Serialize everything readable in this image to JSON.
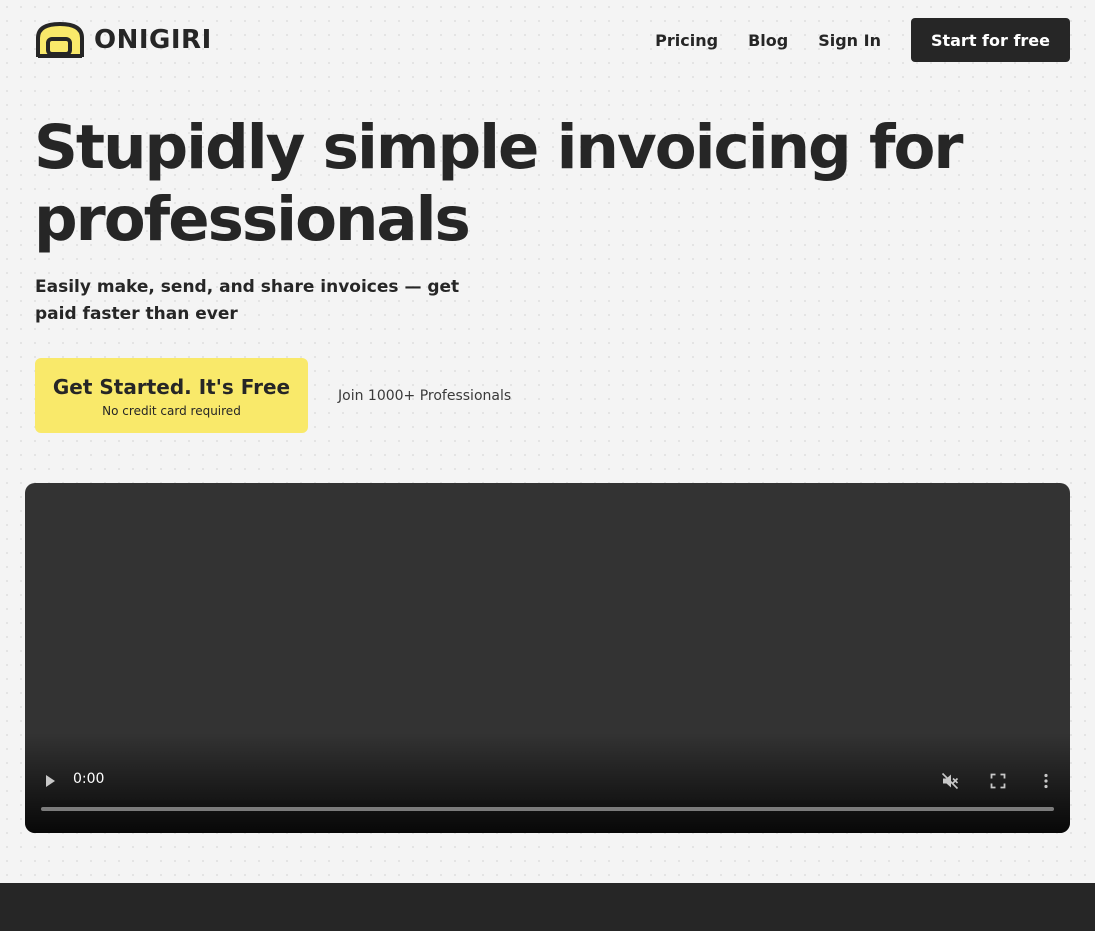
{
  "brand": {
    "name": "ONIGIRI",
    "accent": "#f9e96a",
    "dark": "#262626",
    "logo_icon": "onigiri-icon"
  },
  "nav": {
    "links": [
      {
        "label": "Pricing"
      },
      {
        "label": "Blog"
      },
      {
        "label": "Sign In"
      }
    ],
    "cta_label": "Start for free"
  },
  "hero": {
    "title": "Stupidly simple invoicing for professionals",
    "subtitle": "Easily make, send, and share invoices — get paid faster than ever",
    "cta_label": "Get Started. It's Free",
    "cta_note": "No credit card required",
    "social_proof": "Join 1000+ Professionals"
  },
  "video": {
    "current_time": "0:00",
    "progress": 0,
    "icons": [
      "play-icon",
      "volume-muted-icon",
      "fullscreen-icon",
      "more-vertical-icon"
    ]
  }
}
